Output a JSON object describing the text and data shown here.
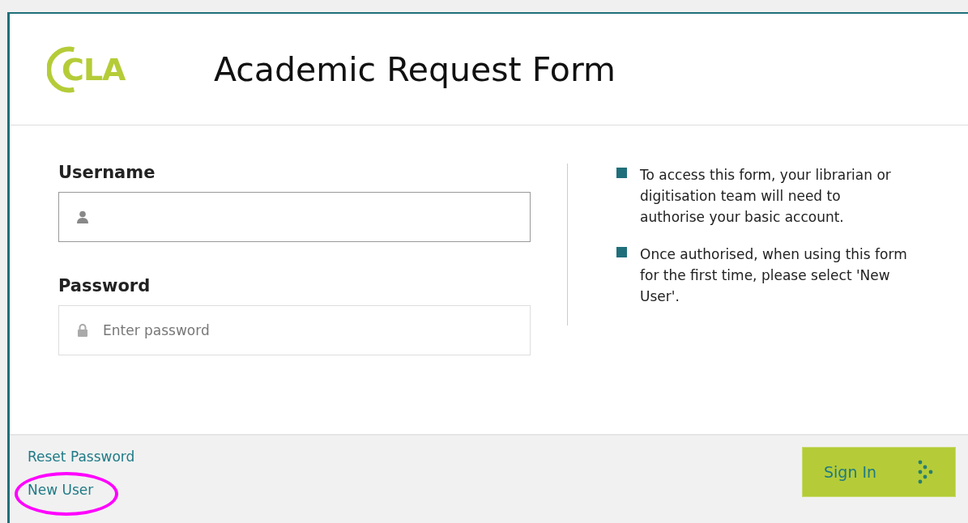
{
  "header": {
    "logo": "CLA",
    "title": "Academic Request Form"
  },
  "fields": [
    {
      "label": "Username",
      "kind": "user",
      "focused": true
    },
    {
      "label": "Password",
      "kind": "password",
      "placeholder": "Enter password",
      "focused": false
    }
  ],
  "notes": [
    "To access this form, your librarian or digitisation team will need to authorise your basic account.",
    "Once authorised, when using this form for the first time, please select 'New User'."
  ],
  "links": [
    {
      "label": "Reset Password",
      "highlighted": false
    },
    {
      "label": "New User",
      "highlighted": true
    }
  ],
  "button": {
    "label": "Sign In"
  }
}
